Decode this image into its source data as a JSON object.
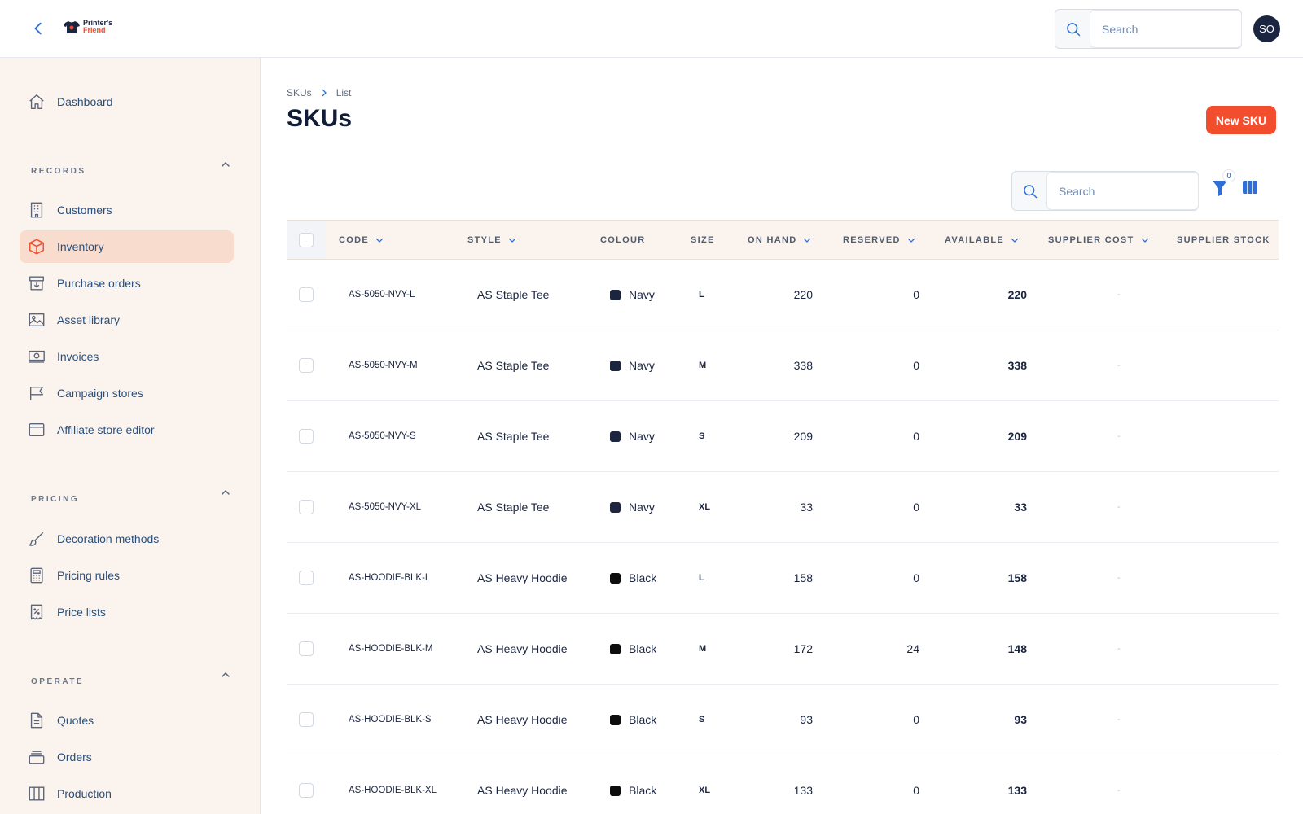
{
  "topbar": {
    "logo_line1": "Printer's",
    "logo_line2": "Friend",
    "search_placeholder": "Search",
    "avatar_initials": "SO"
  },
  "sidebar": {
    "dashboard": "Dashboard",
    "records_heading": "RECORDS",
    "records": [
      {
        "label": "Customers",
        "icon": "building-icon"
      },
      {
        "label": "Inventory",
        "icon": "box-icon",
        "active": true
      },
      {
        "label": "Purchase orders",
        "icon": "inbox-download-icon"
      },
      {
        "label": "Asset library",
        "icon": "image-icon"
      },
      {
        "label": "Invoices",
        "icon": "banknote-icon"
      },
      {
        "label": "Campaign stores",
        "icon": "flag-icon"
      },
      {
        "label": "Affiliate store editor",
        "icon": "browser-window-icon"
      }
    ],
    "pricing_heading": "PRICING",
    "pricing": [
      {
        "label": "Decoration methods",
        "icon": "paintbrush-icon"
      },
      {
        "label": "Pricing rules",
        "icon": "calculator-icon"
      },
      {
        "label": "Price lists",
        "icon": "receipt-percent-icon"
      }
    ],
    "operate_heading": "OPERATE",
    "operate": [
      {
        "label": "Quotes",
        "icon": "document-icon"
      },
      {
        "label": "Orders",
        "icon": "tray-stack-icon"
      },
      {
        "label": "Production",
        "icon": "columns-icon"
      }
    ]
  },
  "main": {
    "breadcrumb": [
      "SKUs",
      "List"
    ],
    "title": "SKUs",
    "new_button": "New SKU",
    "table_search_placeholder": "Search",
    "filter_count": "0",
    "accent_color": "#f24e2e",
    "columns": [
      "CODE",
      "STYLE",
      "COLOUR",
      "SIZE",
      "ON HAND",
      "RESERVED",
      "AVAILABLE",
      "SUPPLIER COST",
      "SUPPLIER STOCK"
    ],
    "rows": [
      {
        "code": "AS-5050-NVY-L",
        "style": "AS Staple Tee",
        "colour": "Navy",
        "swatch": "#1b2540",
        "size": "L",
        "on_hand": "220",
        "reserved": "0",
        "available": "220",
        "supplier_cost": "-"
      },
      {
        "code": "AS-5050-NVY-M",
        "style": "AS Staple Tee",
        "colour": "Navy",
        "swatch": "#1b2540",
        "size": "M",
        "on_hand": "338",
        "reserved": "0",
        "available": "338",
        "supplier_cost": "-"
      },
      {
        "code": "AS-5050-NVY-S",
        "style": "AS Staple Tee",
        "colour": "Navy",
        "swatch": "#1b2540",
        "size": "S",
        "on_hand": "209",
        "reserved": "0",
        "available": "209",
        "supplier_cost": "-"
      },
      {
        "code": "AS-5050-NVY-XL",
        "style": "AS Staple Tee",
        "colour": "Navy",
        "swatch": "#1b2540",
        "size": "XL",
        "on_hand": "33",
        "reserved": "0",
        "available": "33",
        "supplier_cost": "-"
      },
      {
        "code": "AS-HOODIE-BLK-L",
        "style": "AS Heavy Hoodie",
        "colour": "Black",
        "swatch": "#0d0d0d",
        "size": "L",
        "on_hand": "158",
        "reserved": "0",
        "available": "158",
        "supplier_cost": "-"
      },
      {
        "code": "AS-HOODIE-BLK-M",
        "style": "AS Heavy Hoodie",
        "colour": "Black",
        "swatch": "#0d0d0d",
        "size": "M",
        "on_hand": "172",
        "reserved": "24",
        "available": "148",
        "supplier_cost": "-"
      },
      {
        "code": "AS-HOODIE-BLK-S",
        "style": "AS Heavy Hoodie",
        "colour": "Black",
        "swatch": "#0d0d0d",
        "size": "S",
        "on_hand": "93",
        "reserved": "0",
        "available": "93",
        "supplier_cost": "-"
      },
      {
        "code": "AS-HOODIE-BLK-XL",
        "style": "AS Heavy Hoodie",
        "colour": "Black",
        "swatch": "#0d0d0d",
        "size": "XL",
        "on_hand": "133",
        "reserved": "0",
        "available": "133",
        "supplier_cost": "-"
      }
    ]
  }
}
